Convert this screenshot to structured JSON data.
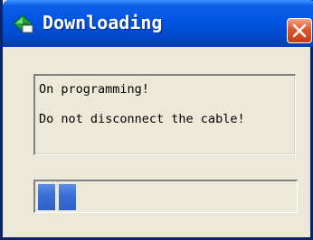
{
  "window": {
    "title": "Downloading",
    "icon": "green-diamond-app-icon",
    "close_icon": "close-icon"
  },
  "message": {
    "line1": "On programming!",
    "line2": "Do not disconnect the cable!"
  },
  "progress": {
    "blocks_filled": 2,
    "fraction": 0.14,
    "fill_color": "#3b6fd8"
  },
  "colors": {
    "titlebar": "#0054e3",
    "close_button": "#e0542e",
    "background": "#ece9d8"
  }
}
